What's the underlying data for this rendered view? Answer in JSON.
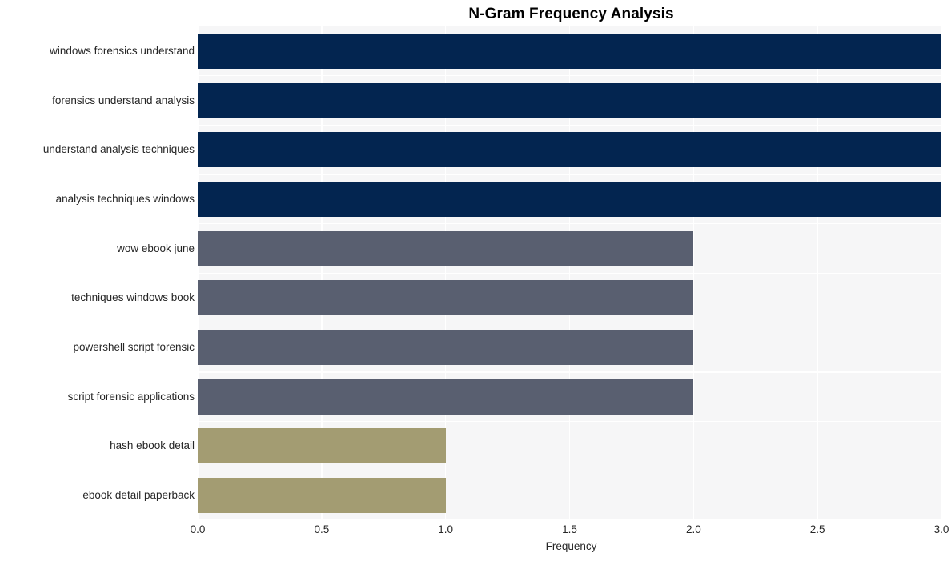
{
  "chart_data": {
    "type": "bar",
    "orientation": "horizontal",
    "title": "N-Gram Frequency Analysis",
    "xlabel": "Frequency",
    "ylabel": "",
    "categories": [
      "windows forensics understand",
      "forensics understand analysis",
      "understand analysis techniques",
      "analysis techniques windows",
      "wow ebook june",
      "techniques windows book",
      "powershell script forensic",
      "script forensic applications",
      "hash ebook detail",
      "ebook detail paperback"
    ],
    "values": [
      3,
      3,
      3,
      3,
      2,
      2,
      2,
      2,
      1,
      1
    ],
    "bar_colors": [
      "#032550",
      "#032550",
      "#032550",
      "#032550",
      "#595f70",
      "#595f70",
      "#595f70",
      "#595f70",
      "#a39c72",
      "#a39c72"
    ],
    "xlim": [
      0,
      3
    ],
    "xticks": [
      0.0,
      0.5,
      1.0,
      1.5,
      2.0,
      2.5,
      3.0
    ],
    "xtick_labels": [
      "0.0",
      "0.5",
      "1.0",
      "1.5",
      "2.0",
      "2.5",
      "3.0"
    ],
    "grid": true,
    "grid_color": "#ffffff",
    "plot_background": "#f6f6f7",
    "figure_background": "#ffffff",
    "legend": null,
    "title_color": "#000000",
    "tick_label_color": "#262626"
  }
}
